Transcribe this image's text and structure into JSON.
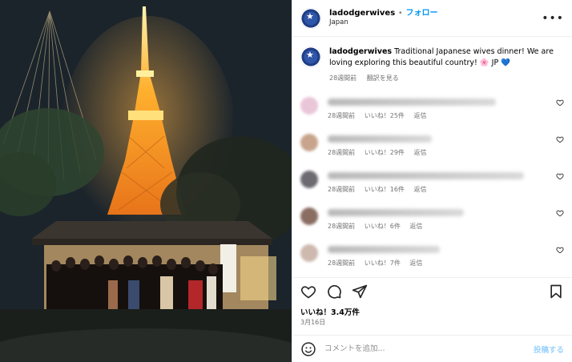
{
  "post": {
    "username": "ladodgerwives",
    "separator": "•",
    "follow_label": "フォロー",
    "location": "Japan",
    "more_label": "•••"
  },
  "caption": {
    "username": "ladodgerwives",
    "text": "Traditional Japanese wives dinner! We are loving exploring this beautiful country! 🌸 JP 💙",
    "time": "28週間前",
    "translate_label": "翻訳を見る"
  },
  "comments": [
    {
      "time": "28週間前",
      "likes": "いいね！25件",
      "reply": "返信",
      "avatar_color": "#e9c6d8"
    },
    {
      "time": "28週間前",
      "likes": "いいね！29件",
      "reply": "返信",
      "avatar_color": "#c8a48c"
    },
    {
      "time": "28週間前",
      "likes": "いいね！16件",
      "reply": "返信",
      "avatar_color": "#6d6a72"
    },
    {
      "time": "28週間前",
      "likes": "いいね！6件",
      "reply": "返信",
      "avatar_color": "#8a6e62"
    },
    {
      "time": "28週間前",
      "likes": "いいね！7件",
      "reply": "返信",
      "avatar_color": "#cdb9ae"
    }
  ],
  "likes_total": "いいね！3.4万件",
  "post_date": "3月16日",
  "add_comment": {
    "placeholder": "コメントを追加...",
    "post_label": "投稿する"
  },
  "colors": {
    "accent": "#0095f6",
    "muted": "#737373"
  },
  "icons": [
    "heart-icon",
    "comment-icon",
    "share-icon",
    "bookmark-icon",
    "emoji-icon",
    "small-heart-icon"
  ]
}
